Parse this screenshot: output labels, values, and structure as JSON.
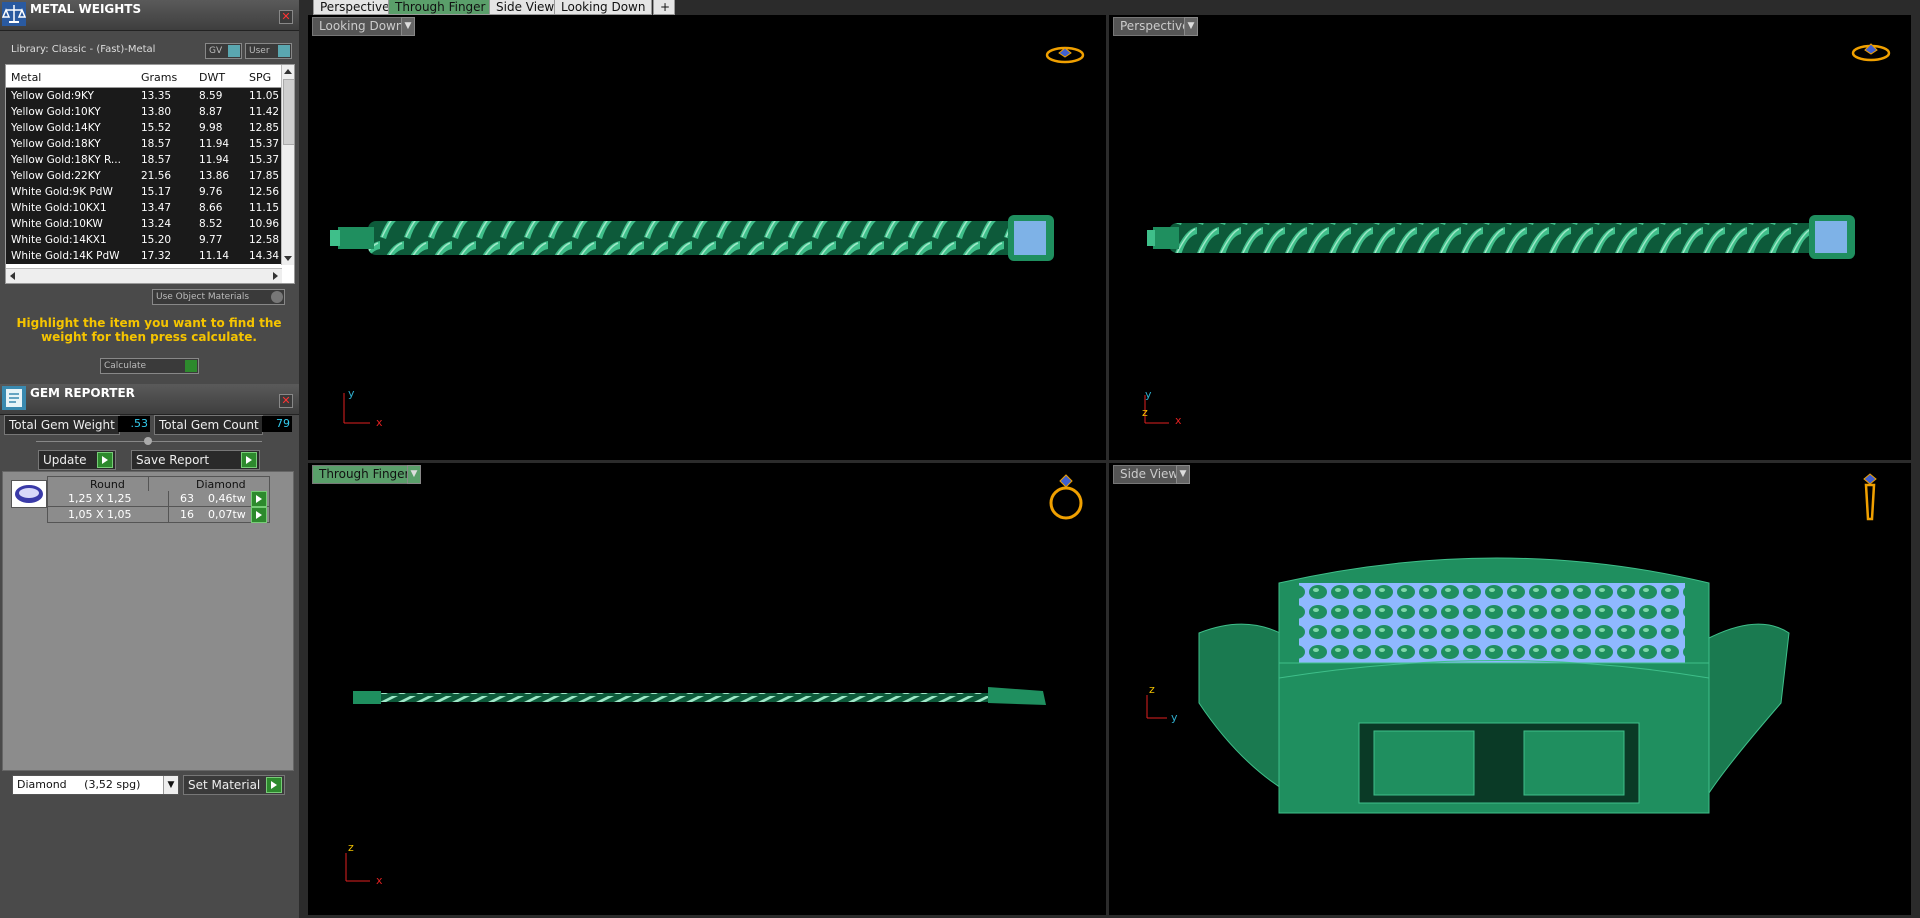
{
  "tabs": [
    {
      "label": "Perspective"
    },
    {
      "label": "Through Finger",
      "active": true
    },
    {
      "label": "Side View"
    },
    {
      "label": "Looking Down"
    },
    {
      "label": "+"
    }
  ],
  "metal_weights": {
    "title": "METAL WEIGHTS",
    "library": "Library: Classic - (Fast)-Metal",
    "toggle_gv": "GV",
    "toggle_user": "User",
    "columns": [
      "Metal",
      "Grams",
      "DWT",
      "SPG"
    ],
    "rows": [
      [
        "Yellow Gold:9KY",
        "13.35",
        "8.59",
        "11.05"
      ],
      [
        "Yellow Gold:10KY",
        "13.80",
        "8.87",
        "11.42"
      ],
      [
        "Yellow Gold:14KY",
        "15.52",
        "9.98",
        "12.85"
      ],
      [
        "Yellow Gold:18KY",
        "18.57",
        "11.94",
        "15.37"
      ],
      [
        "Yellow Gold:18KY R...",
        "18.57",
        "11.94",
        "15.37"
      ],
      [
        "Yellow Gold:22KY",
        "21.56",
        "13.86",
        "17.85"
      ],
      [
        "White Gold:9K PdW",
        "15.17",
        "9.76",
        "12.56"
      ],
      [
        "White Gold:10KX1",
        "13.47",
        "8.66",
        "11.15"
      ],
      [
        "White Gold:10KW",
        "13.24",
        "8.52",
        "10.96"
      ],
      [
        "White Gold:14KX1",
        "15.20",
        "9.77",
        "12.58"
      ],
      [
        "White Gold:14K PdW",
        "17.32",
        "11.14",
        "14.34"
      ]
    ],
    "use_object_materials": "Use Object Materials",
    "hint": "Highlight the item you want to find the weight for then press calculate.",
    "calculate": "Calculate"
  },
  "gem_reporter": {
    "title": "GEM REPORTER",
    "total_weight_label": "Total Gem Weight",
    "total_weight_value": ".53",
    "total_count_label": "Total Gem Count",
    "total_count_value": "79",
    "update": "Update",
    "save_report": "Save Report",
    "gem_cols": [
      "Round",
      "Diamond"
    ],
    "gems": [
      {
        "size": "1,25 X 1,25",
        "count": "63",
        "weight": "0,46tw"
      },
      {
        "size": "1,05 X 1,05",
        "count": "16",
        "weight": "0,07tw"
      }
    ],
    "material_select": "Diamond     (3,52 spg)",
    "set_material": "Set Material"
  },
  "viewports": [
    {
      "label": "Looking Down",
      "axis1": "y",
      "axis2": "x"
    },
    {
      "label": "Perspective",
      "axis1": "y",
      "axis2": "x",
      "axis3": "z"
    },
    {
      "label": "Through Finger",
      "axis1": "z",
      "axis2": "x"
    },
    {
      "label": "Side View",
      "axis1": "z",
      "axis2": "y"
    }
  ],
  "colors": {
    "model": "#1f8f5f",
    "model_light": "#3fbf8a",
    "accent_active": "#5a9f6a",
    "axis_red": "#e02020",
    "axis_cyan": "#20b0d0"
  }
}
